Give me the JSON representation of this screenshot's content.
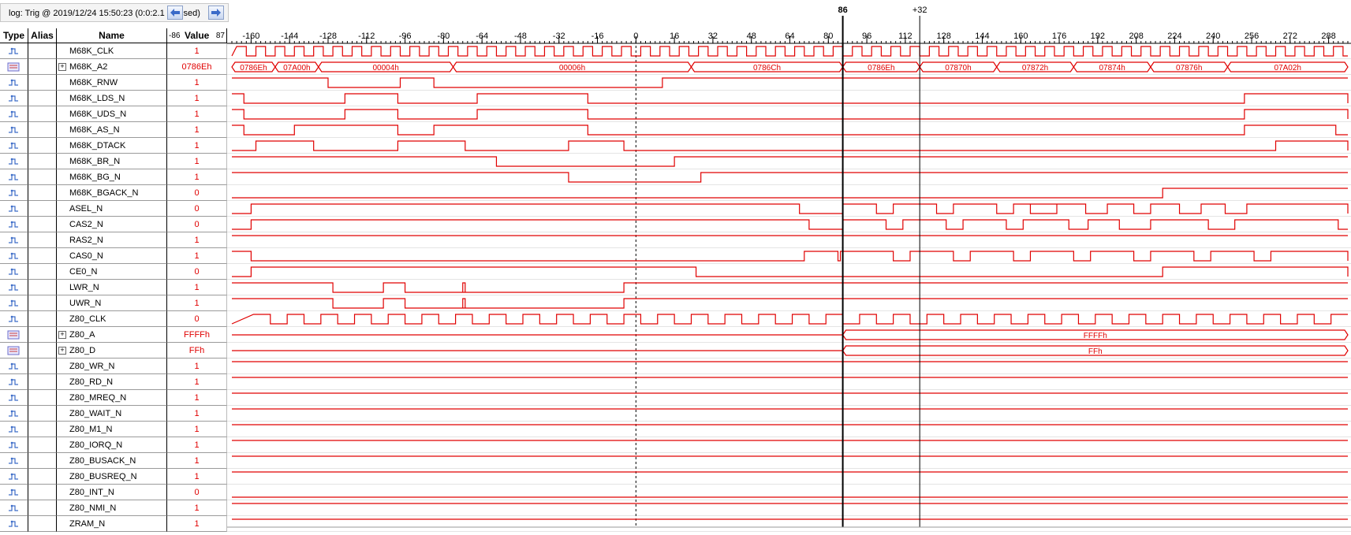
{
  "log_title": "log: Trig @ 2019/12/24 15:50:23 (0:0:2.1 elapsed)",
  "nav": {
    "back_icon": "arrow-left-icon",
    "forward_icon": "arrow-right-icon"
  },
  "columns": {
    "type": "Type",
    "alias": "Alias",
    "name": "Name",
    "value": "Value"
  },
  "range": {
    "left": "-86",
    "right": "87"
  },
  "cursors": {
    "main_label": "86",
    "delta_label": "+32"
  },
  "timeline": {
    "start": -168,
    "end": 296,
    "ticks": [
      -160,
      -144,
      -128,
      -112,
      -96,
      -80,
      -64,
      -48,
      -32,
      -16,
      0,
      16,
      32,
      48,
      64,
      80,
      96,
      112,
      128,
      144,
      160,
      176,
      192,
      208,
      224,
      240,
      256,
      272,
      288
    ]
  },
  "colors": {
    "wave": "#e00000",
    "grid": "#000000",
    "cursor": "#000000"
  },
  "signals": [
    {
      "name": "M68K_CLK",
      "value": "1",
      "kind": "clk"
    },
    {
      "name": "M68K_A2",
      "value": "0786Eh",
      "kind": "bus",
      "expand": true
    },
    {
      "name": "M68K_RNW",
      "value": "1",
      "kind": "bit"
    },
    {
      "name": "M68K_LDS_N",
      "value": "1",
      "kind": "bit"
    },
    {
      "name": "M68K_UDS_N",
      "value": "1",
      "kind": "bit"
    },
    {
      "name": "M68K_AS_N",
      "value": "1",
      "kind": "bit"
    },
    {
      "name": "M68K_DTACK",
      "value": "1",
      "kind": "bit"
    },
    {
      "name": "M68K_BR_N",
      "value": "1",
      "kind": "bit"
    },
    {
      "name": "M68K_BG_N",
      "value": "1",
      "kind": "bit"
    },
    {
      "name": "M68K_BGACK_N",
      "value": "0",
      "kind": "bit"
    },
    {
      "name": "ASEL_N",
      "value": "0",
      "kind": "bit"
    },
    {
      "name": "CAS2_N",
      "value": "0",
      "kind": "bit"
    },
    {
      "name": "RAS2_N",
      "value": "1",
      "kind": "bit"
    },
    {
      "name": "CAS0_N",
      "value": "1",
      "kind": "bit"
    },
    {
      "name": "CE0_N",
      "value": "0",
      "kind": "bit"
    },
    {
      "name": "LWR_N",
      "value": "1",
      "kind": "bit"
    },
    {
      "name": "UWR_N",
      "value": "1",
      "kind": "bit"
    },
    {
      "name": "Z80_CLK",
      "value": "0",
      "kind": "clk"
    },
    {
      "name": "Z80_A",
      "value": "FFFFh",
      "kind": "bus",
      "expand": true
    },
    {
      "name": "Z80_D",
      "value": "FFh",
      "kind": "bus",
      "expand": true
    },
    {
      "name": "Z80_WR_N",
      "value": "1",
      "kind": "bit"
    },
    {
      "name": "Z80_RD_N",
      "value": "1",
      "kind": "bit"
    },
    {
      "name": "Z80_MREQ_N",
      "value": "1",
      "kind": "bit"
    },
    {
      "name": "Z80_WAIT_N",
      "value": "1",
      "kind": "bit"
    },
    {
      "name": "Z80_M1_N",
      "value": "1",
      "kind": "bit"
    },
    {
      "name": "Z80_IORQ_N",
      "value": "1",
      "kind": "bit"
    },
    {
      "name": "Z80_BUSACK_N",
      "value": "1",
      "kind": "bit"
    },
    {
      "name": "Z80_BUSREQ_N",
      "value": "1",
      "kind": "bit"
    },
    {
      "name": "Z80_INT_N",
      "value": "0",
      "kind": "bit"
    },
    {
      "name": "Z80_NMI_N",
      "value": "1",
      "kind": "bit"
    },
    {
      "name": "ZRAM_N",
      "value": "1",
      "kind": "bit"
    }
  ],
  "bus_segments": {
    "M68K_A2": [
      {
        "from": -168,
        "to": -150,
        "label": "0786Eh"
      },
      {
        "from": -150,
        "to": -132,
        "label": "07A00h"
      },
      {
        "from": -132,
        "to": -76,
        "label": "00004h"
      },
      {
        "from": -76,
        "to": 23,
        "label": "00006h"
      },
      {
        "from": 23,
        "to": 86,
        "label": "0786Ch"
      },
      {
        "from": 86,
        "to": 118,
        "label": "0786Eh"
      },
      {
        "from": 118,
        "to": 150,
        "label": "07870h"
      },
      {
        "from": 150,
        "to": 182,
        "label": "07872h"
      },
      {
        "from": 182,
        "to": 214,
        "label": "07874h"
      },
      {
        "from": 214,
        "to": 246,
        "label": "07876h"
      },
      {
        "from": 246,
        "to": 296,
        "label": "07A02h"
      }
    ],
    "Z80_A": [
      {
        "from": -168,
        "to": 86,
        "label": ""
      },
      {
        "from": 86,
        "to": 296,
        "label": "FFFFh"
      }
    ],
    "Z80_D": [
      {
        "from": -168,
        "to": 86,
        "label": ""
      },
      {
        "from": 86,
        "to": 296,
        "label": "FFh"
      }
    ]
  },
  "transitions": {
    "M68K_RNW": {
      "init": 1,
      "edges": [
        -128,
        -98,
        -84,
        11
      ]
    },
    "M68K_LDS_N": {
      "init": 1,
      "edges": [
        -163,
        -121,
        -99,
        -66,
        -20,
        253,
        296
      ]
    },
    "M68K_UDS_N": {
      "init": 1,
      "edges": [
        -163,
        -121,
        -99,
        -66,
        -20,
        253,
        296
      ]
    },
    "M68K_AS_N": {
      "init": 1,
      "edges": [
        -163,
        -142,
        -99,
        -84,
        -20,
        253,
        291
      ]
    },
    "M68K_DTACK": {
      "init": 0,
      "edges": [
        -158,
        -134,
        -99,
        -71,
        -28,
        -5,
        266,
        296
      ]
    },
    "M68K_BR_N": {
      "init": 1,
      "edges": [
        -58,
        16
      ]
    },
    "M68K_BG_N": {
      "init": 1,
      "edges": [
        -28,
        27
      ]
    },
    "M68K_BGACK_N": {
      "init": 0,
      "edges": [
        219
      ]
    },
    "ASEL_N": {
      "init": 0,
      "edges": [
        -160,
        68,
        86,
        100,
        107,
        125,
        132,
        150,
        157,
        175,
        164,
        187,
        196,
        207,
        214,
        226,
        235,
        245,
        254,
        296
      ]
    },
    "CAS2_N": {
      "init": 0,
      "edges": [
        -160,
        72,
        86,
        104,
        111,
        129,
        136,
        154,
        161,
        180,
        188,
        201,
        214,
        238,
        249,
        292
      ]
    },
    "RAS2_N": {
      "init": 1,
      "edges": []
    },
    "CAS0_N": {
      "init": 1,
      "edges": [
        -160,
        70,
        84,
        85,
        107,
        114,
        132,
        139,
        157,
        164,
        182,
        189,
        207,
        214,
        232,
        239,
        257,
        264,
        296
      ]
    },
    "CE0_N": {
      "init": 0,
      "edges": [
        -160,
        25,
        219,
        296
      ]
    },
    "LWR_N": {
      "init": 1,
      "edges": [
        -126,
        -105,
        -96,
        -71,
        -72,
        -5
      ]
    },
    "UWR_N": {
      "init": 1,
      "edges": [
        -126,
        -105,
        -96,
        -71,
        -72,
        -5
      ]
    },
    "Z80_WR_N": {
      "init": 1,
      "edges": []
    },
    "Z80_RD_N": {
      "init": 1,
      "edges": []
    },
    "Z80_MREQ_N": {
      "init": 1,
      "edges": []
    },
    "Z80_WAIT_N": {
      "init": 1,
      "edges": []
    },
    "Z80_M1_N": {
      "init": 1,
      "edges": []
    },
    "Z80_IORQ_N": {
      "init": 1,
      "edges": []
    },
    "Z80_BUSACK_N": {
      "init": 1,
      "edges": []
    },
    "Z80_BUSREQ_N": {
      "init": 1,
      "edges": []
    },
    "Z80_INT_N": {
      "init": 0,
      "edges": []
    },
    "Z80_NMI_N": {
      "init": 1,
      "edges": []
    },
    "ZRAM_N": {
      "init": 1,
      "edges": []
    }
  },
  "clocks": {
    "M68K_CLK": {
      "period": 8,
      "phase": -166
    },
    "Z80_CLK": {
      "period": 14,
      "phase": -159
    }
  },
  "markers": {
    "zero": 0,
    "cursor": 86,
    "delta": 118
  }
}
